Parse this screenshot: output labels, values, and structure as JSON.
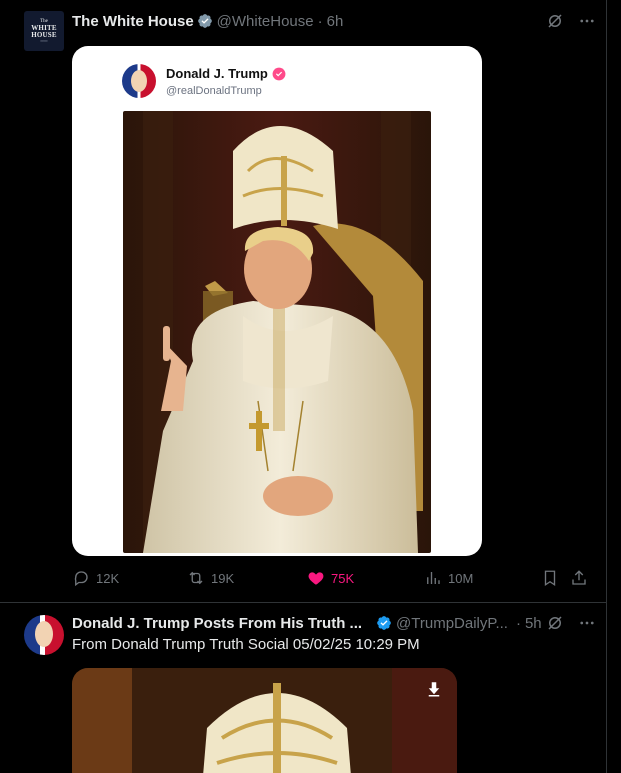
{
  "post1": {
    "author_name": "The White House",
    "author_handle": "@WhiteHouse",
    "time": "6h",
    "avatar_text": {
      "line1": "The",
      "line2a": "WHITE",
      "line2b": "HOUSE"
    },
    "embed": {
      "name": "Donald J. Trump",
      "handle": "@realDonaldTrump"
    },
    "stats": {
      "replies": "12K",
      "reposts": "19K",
      "likes": "75K",
      "views": "10M"
    }
  },
  "post2": {
    "author_name": "Donald J. Trump Posts From His Truth ...",
    "author_handle": "@TrumpDailyP...",
    "time": "5h",
    "text": "From Donald Trump Truth Social 05/02/25 10:29 PM"
  },
  "colors": {
    "background": "#000000",
    "text": "#e7e9ea",
    "muted": "#71767b",
    "divider": "#2f3336",
    "verified_blue": "#1d9bf0",
    "verified_gray": "#829aab",
    "like_pink": "#f91880",
    "truth_badge": "#ff4a8a"
  },
  "icons": {
    "grok": "grok-icon",
    "more": "more-icon",
    "reply": "reply-icon",
    "repost": "repost-icon",
    "like": "heart-icon",
    "views": "views-icon",
    "bookmark": "bookmark-icon",
    "share": "share-icon",
    "download": "download-icon"
  }
}
